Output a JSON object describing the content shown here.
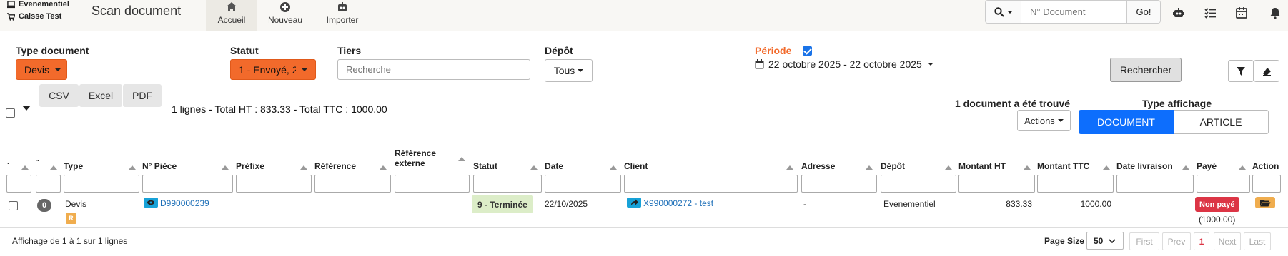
{
  "header": {
    "context_shop": "Evenementiel",
    "context_register": "Caisse Test",
    "app_title": "Scan document",
    "tabs": [
      {
        "label": "Accueil",
        "icon": "home-icon",
        "active": true
      },
      {
        "label": "Nouveau",
        "icon": "plus-circle-icon",
        "active": false
      },
      {
        "label": "Importer",
        "icon": "robot-icon",
        "active": false
      }
    ],
    "search": {
      "placeholder": "N° Document",
      "go_label": "Go!"
    }
  },
  "filters": {
    "type_document": {
      "label": "Type document",
      "value": "Devis"
    },
    "statut": {
      "label": "Statut",
      "value": "1 - Envoyé, 2"
    },
    "tiers": {
      "label": "Tiers",
      "placeholder": "Recherche"
    },
    "depot": {
      "label": "Dépôt",
      "value": "Tous"
    },
    "periode": {
      "label": "Période",
      "checked": true,
      "range": "22 octobre 2025 - 22 octobre 2025"
    },
    "search_button": "Rechercher"
  },
  "toolbar": {
    "export_buttons": [
      "CSV",
      "Excel",
      "PDF"
    ],
    "summary": "1 lignes - Total HT : 833.33 - Total TTC : 1000.00",
    "found_text": "1 document a été trouvé",
    "actions_label": "Actions",
    "display_type_label": "Type affichage",
    "display_options": [
      {
        "label": "DOCUMENT",
        "active": true
      },
      {
        "label": "ARTICLE",
        "active": false
      }
    ]
  },
  "table": {
    "columns": {
      "c1": "`",
      "c2": "¨",
      "type": "Type",
      "numero": "N° Pièce",
      "prefixe": "Préfixe",
      "reference": "Référence",
      "ref_ext_1": "Référence",
      "ref_ext_2": "externe",
      "statut": "Statut",
      "date": "Date",
      "client": "Client",
      "adresse": "Adresse",
      "depot": "Dépôt",
      "montant_ht": "Montant HT",
      "montant_ttc": "Montant TTC",
      "date_livraison": "Date livraison",
      "paye": "Payé",
      "action": "Action"
    },
    "rows": [
      {
        "count": "0",
        "type": "Devis",
        "type_tag": "R",
        "numero": "D990000239",
        "prefixe": "",
        "reference": "",
        "ref_externe": "",
        "statut": "9 - Terminée",
        "date": "22/10/2025",
        "client": "X990000272 - test",
        "adresse": "-",
        "depot": "Evenementiel",
        "montant_ht": "833.33",
        "montant_ttc": "1000.00",
        "date_livraison": "",
        "paye": "Non payé",
        "paye_amount": "(1000.00)"
      }
    ]
  },
  "footer": {
    "info": "Affichage de 1 à 1 sur 1 lignes",
    "page_size_label": "Page Size",
    "page_size_value": "50",
    "pager": {
      "first": "First",
      "prev": "Prev",
      "current": "1",
      "next": "Next",
      "last": "Last"
    }
  },
  "colors": {
    "accent_orange": "#f26a2b",
    "primary_blue": "#0d6efd",
    "link_blue": "#1d6fb8",
    "status_green_bg": "#dcedc8",
    "unpaid_red": "#dc3545"
  }
}
